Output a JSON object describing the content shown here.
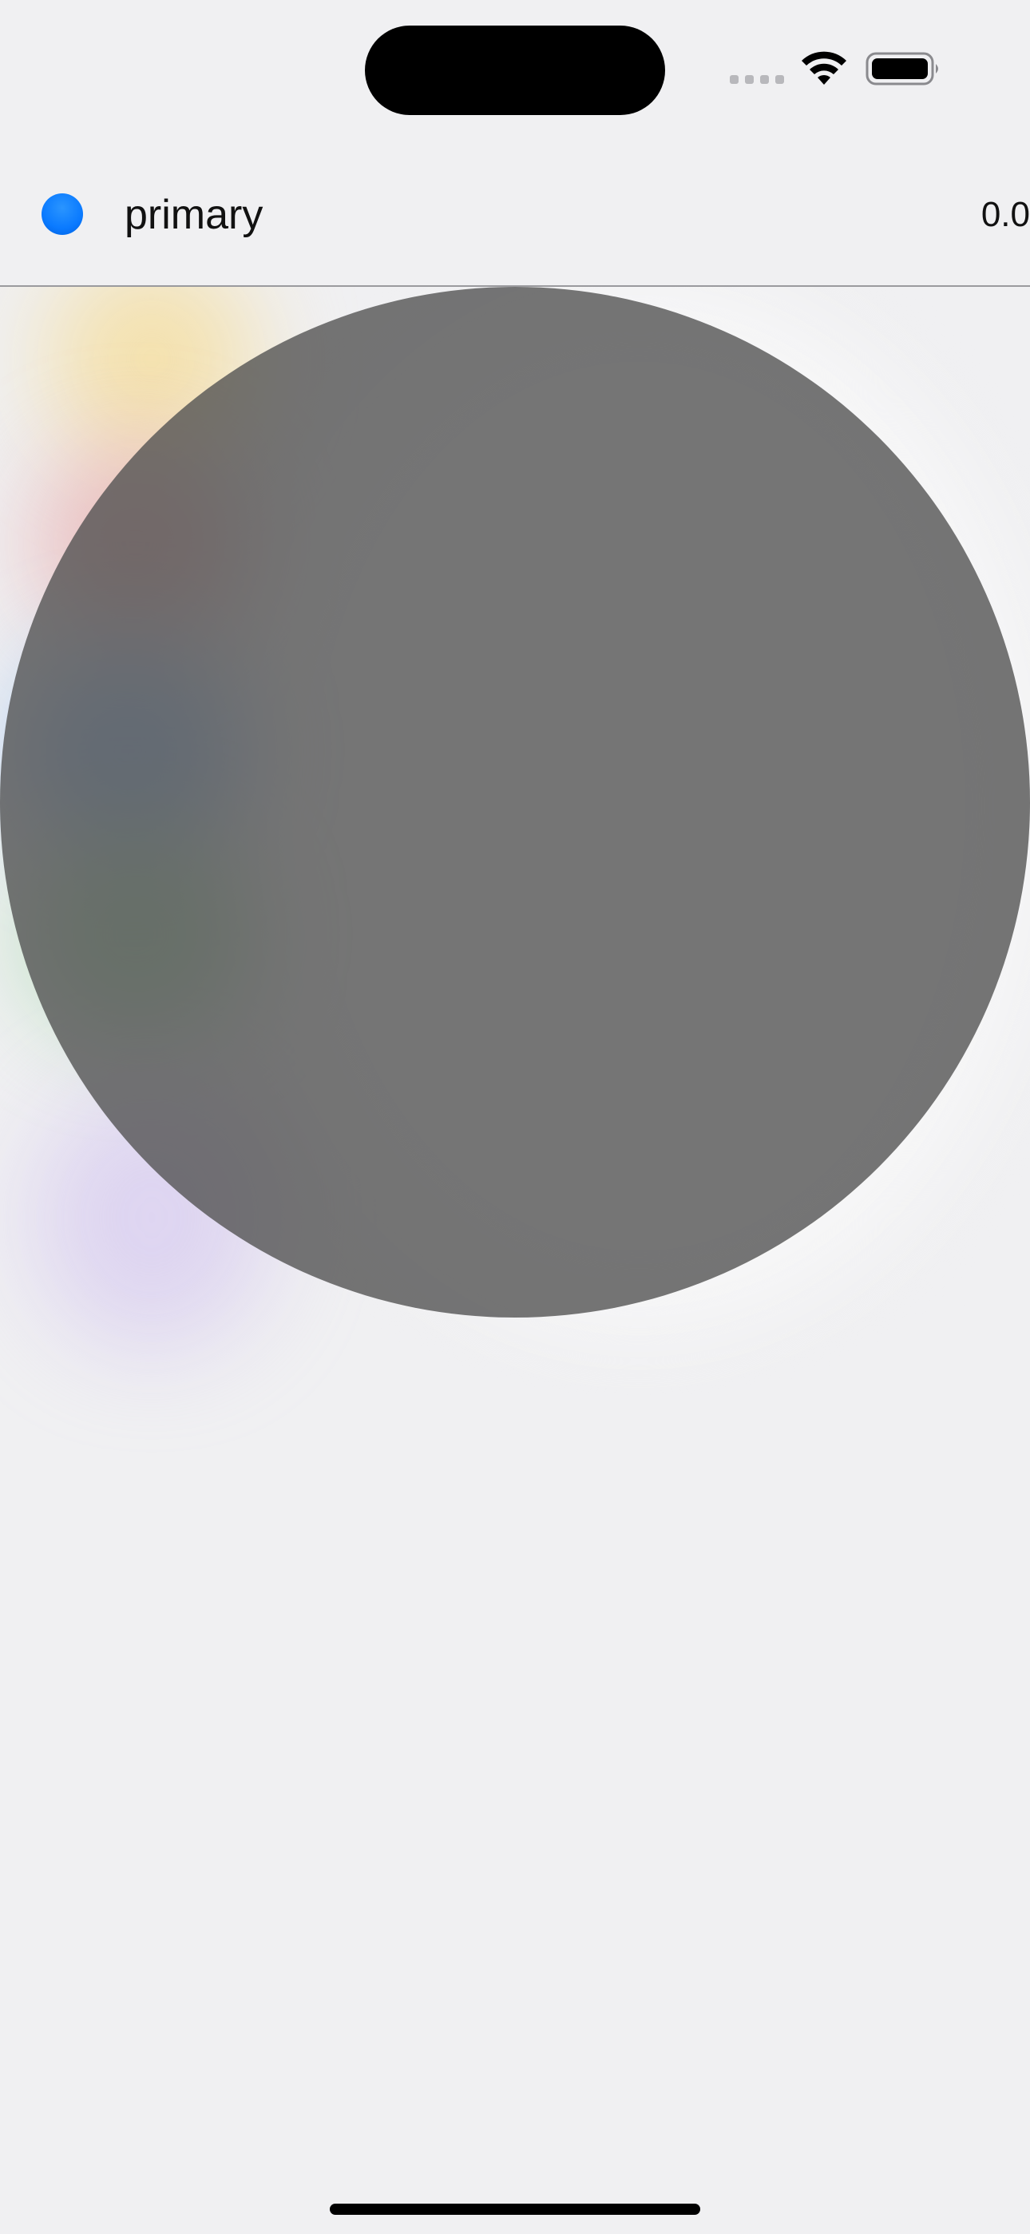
{
  "status_bar": {
    "signal_icon": "cellular-signal-icon",
    "wifi_icon": "wifi-icon",
    "battery_icon": "battery-icon"
  },
  "row": {
    "color_name": "primary",
    "value": "0.0",
    "swatch_color": "#0a7aff"
  },
  "colors": {
    "background": "#f0f0f2",
    "circle": "#6e6e6e"
  }
}
